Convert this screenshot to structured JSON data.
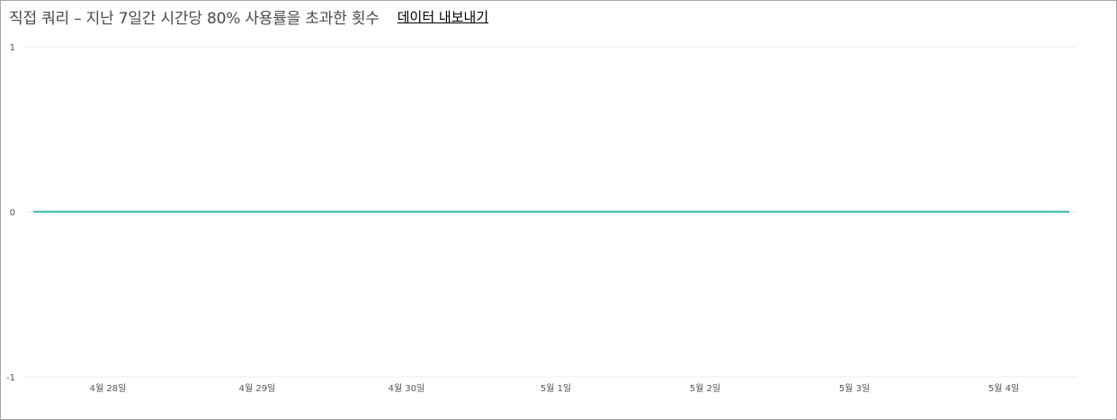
{
  "header": {
    "title": "직접 쿼리 – 지난 7일간 시간당 80% 사용률을 초과한 횟수",
    "export_label": "데이터 내보내기"
  },
  "colors": {
    "series": "#2cb5a4",
    "grid": "#ececec",
    "text": "#555555"
  },
  "chart_data": {
    "type": "line",
    "title": "직접 쿼리 – 지난 7일간 시간당 80% 사용률을 초과한 횟수",
    "xlabel": "",
    "ylabel": "",
    "categories": [
      "4월 28일",
      "4월 29일",
      "4월 30일",
      "5월 1일",
      "5월 2일",
      "5월 3일",
      "5월 4일"
    ],
    "ylim": [
      -1,
      1
    ],
    "yticks": [
      "1",
      "0",
      "-1"
    ],
    "grid": true,
    "series": [
      {
        "values": [
          0,
          0,
          0,
          0,
          0,
          0,
          0
        ]
      }
    ]
  }
}
